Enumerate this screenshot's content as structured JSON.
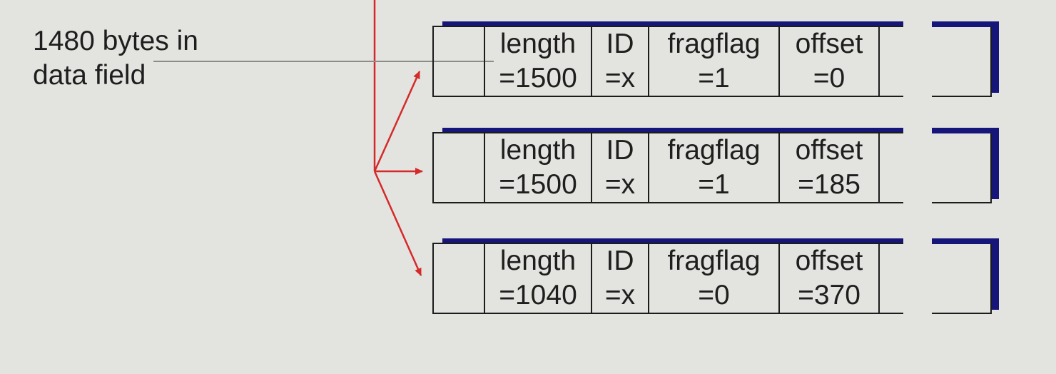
{
  "caption": {
    "line1": "1480 bytes in",
    "line2": "data field"
  },
  "fragments": [
    {
      "length_label": "length",
      "length_value": "=1500",
      "id_label": "ID",
      "id_value": "=x",
      "fragflag_label": "fragflag",
      "fragflag_value": "=1",
      "offset_label": "offset",
      "offset_value": "=0"
    },
    {
      "length_label": "length",
      "length_value": "=1500",
      "id_label": "ID",
      "id_value": "=x",
      "fragflag_label": "fragflag",
      "fragflag_value": "=1",
      "offset_label": "offset",
      "offset_value": "=185"
    },
    {
      "length_label": "length",
      "length_value": "=1040",
      "id_label": "ID",
      "id_value": "=x",
      "fragflag_label": "fragflag",
      "fragflag_value": "=0",
      "offset_label": "offset",
      "offset_value": "=370"
    }
  ],
  "colors": {
    "arrow": "#d42a2a",
    "header_bar": "#15157a",
    "background": "#e3e3df"
  }
}
